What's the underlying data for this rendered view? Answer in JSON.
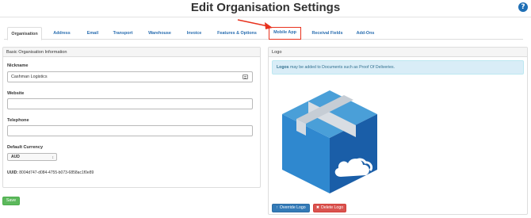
{
  "header": {
    "title": "Edit Organisation Settings",
    "help_icon": "?"
  },
  "tabs": [
    {
      "label": "Organisation",
      "active": true
    },
    {
      "label": "Address"
    },
    {
      "label": "Email"
    },
    {
      "label": "Transport"
    },
    {
      "label": "Warehouse"
    },
    {
      "label": "Invoice"
    },
    {
      "label": "Features & Options"
    },
    {
      "label": "Mobile App",
      "highlighted": true
    },
    {
      "label": "Receival Fields"
    },
    {
      "label": "Add-Ons"
    }
  ],
  "basic_info": {
    "heading": "Basic Organisation Information",
    "nickname_label": "Nickname",
    "nickname_value": "Cashman Logistics",
    "website_label": "Website",
    "website_value": "",
    "telephone_label": "Telephone",
    "telephone_value": "",
    "currency_label": "Default Currency",
    "currency_value": "AUD",
    "uuid_label": "UUID:",
    "uuid_value": "8004d747-d084-4755-b073-6858ac1f0e89"
  },
  "logo": {
    "heading": "Logo",
    "info_bold": "Logos",
    "info_text": " may be added to Documents such as Proof Of Deliveries.",
    "override_label": "Override Logo",
    "delete_label": "Delete Logo"
  },
  "actions": {
    "save_label": "Save"
  },
  "colors": {
    "link": "#2a6eb0",
    "highlight": "#e8321e",
    "save": "#5cb85c",
    "primary": "#337ab7",
    "danger": "#d9534f",
    "info_bg": "#d9edf7"
  },
  "icons": {
    "help": "question-circle-icon",
    "upload": "upload-icon",
    "trash": "trash-icon",
    "list": "list-icon",
    "arrow": "annotation-arrow-icon"
  }
}
